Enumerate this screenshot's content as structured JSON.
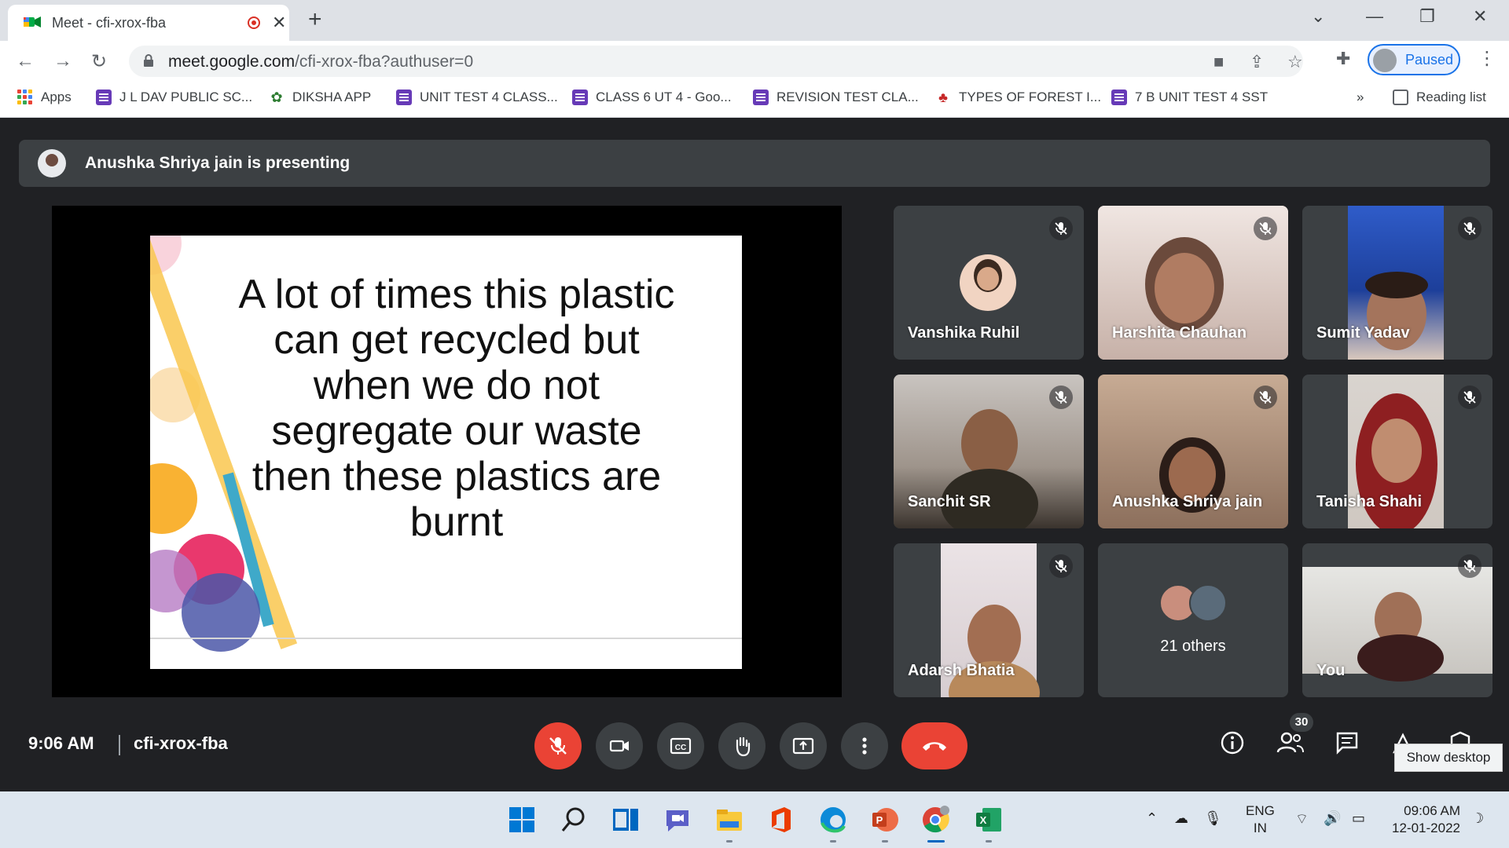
{
  "browser": {
    "tab_title": "Meet - cfi-xrox-fba",
    "url_host": "meet.google.com",
    "url_path": "/cfi-xrox-fba?authuser=0",
    "profile_label": "Paused",
    "bookmarks": [
      {
        "label": "Apps",
        "icon": "apps-grid-icon"
      },
      {
        "label": "J L DAV PUBLIC SC...",
        "icon": "forms-icon"
      },
      {
        "label": "DIKSHA APP",
        "icon": "diksha-icon"
      },
      {
        "label": "UNIT TEST 4 CLASS...",
        "icon": "forms-icon"
      },
      {
        "label": "CLASS 6 UT 4 - Goo...",
        "icon": "forms-icon"
      },
      {
        "label": "REVISION TEST CLA...",
        "icon": "forms-icon"
      },
      {
        "label": "TYPES OF FOREST I...",
        "icon": "forest-icon"
      },
      {
        "label": "7 B UNIT TEST 4 SST",
        "icon": "forms-icon"
      }
    ],
    "bookmarks_overflow": "»",
    "reading_list": "Reading list"
  },
  "meet": {
    "presenting_banner": "Anushka Shriya jain is presenting",
    "slide_text_lines": [
      "A lot of times this plastic",
      "can get recycled but",
      "when we do not",
      "segregate our waste",
      "then these plastics are",
      "burnt"
    ],
    "participants": [
      "Vanshika Ruhil",
      "Harshita Chauhan",
      "Sumit Yadav",
      "Sanchit SR",
      "Anushka Shriya jain",
      "Tanisha Shahi",
      "Adarsh Bhatia",
      "21 others",
      "You"
    ],
    "time": "9:06 AM",
    "meeting_code": "cfi-xrox-fba",
    "people_count": "30",
    "tooltip": "Show desktop"
  },
  "taskbar": {
    "lang_top": "ENG",
    "lang_bottom": "IN",
    "clock_time": "09:06 AM",
    "clock_date": "12-01-2022"
  },
  "colors": {
    "meet_bg": "#202124",
    "tile_bg": "#3c4043",
    "danger": "#ea4335",
    "accent": "#1a73e8"
  }
}
